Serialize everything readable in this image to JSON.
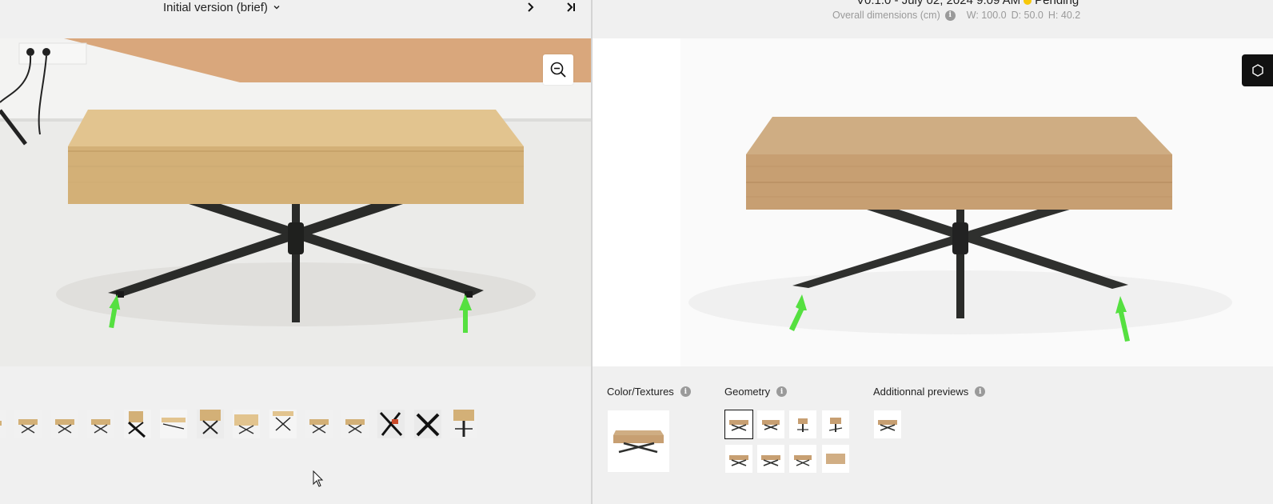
{
  "left_panel": {
    "version_label": "Initial version (brief)",
    "nav_next": "›",
    "nav_last": "›|"
  },
  "right_panel": {
    "version_info": "V0.1.0 - July 02, 2024 9:09 AM",
    "status": "Pending",
    "dimensions_label": "Overall dimensions (cm)",
    "width": "W: 100.0",
    "depth": "D: 50.0",
    "height": "H: 40.2",
    "sections": {
      "color_textures": "Color/Textures",
      "geometry": "Geometry",
      "additional_previews": "Additionnal previews"
    }
  },
  "colors": {
    "status_dot": "#f7c80a",
    "annotation_arrow": "#55e040",
    "wood": "#d4b07c",
    "metal": "#2f302e"
  },
  "icons": {
    "zoom": "zoom-out-icon",
    "info": "info-icon",
    "chevron": "chevron-down-icon"
  }
}
